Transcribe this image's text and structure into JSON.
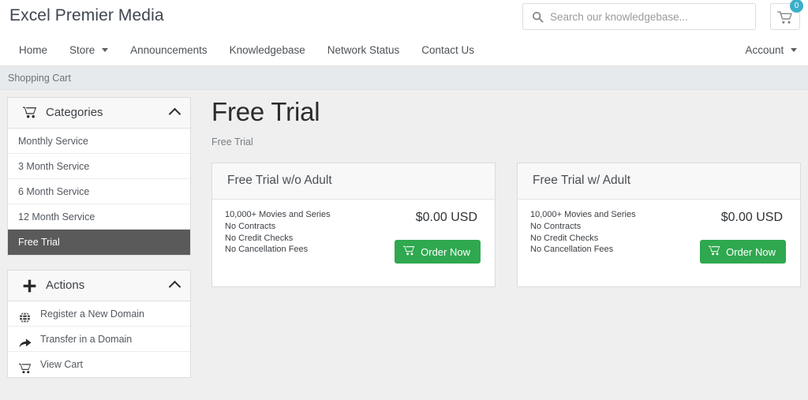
{
  "header": {
    "brand": "Excel Premier Media",
    "search_placeholder": "Search our knowledgebase...",
    "search_value": "",
    "cart_count": "0"
  },
  "nav": {
    "items": [
      {
        "label": "Home",
        "has_caret": false
      },
      {
        "label": "Store",
        "has_caret": true
      },
      {
        "label": "Announcements",
        "has_caret": false
      },
      {
        "label": "Knowledgebase",
        "has_caret": false
      },
      {
        "label": "Network Status",
        "has_caret": false
      },
      {
        "label": "Contact Us",
        "has_caret": false
      }
    ],
    "account_label": "Account"
  },
  "breadcrumb": {
    "text": "Shopping Cart"
  },
  "sidebar": {
    "categories": {
      "title": "Categories",
      "items": [
        {
          "label": "Monthly Service",
          "active": false
        },
        {
          "label": "3 Month Service",
          "active": false
        },
        {
          "label": "6 Month Service",
          "active": false
        },
        {
          "label": "12 Month Service",
          "active": false
        },
        {
          "label": "Free Trial",
          "active": true
        }
      ]
    },
    "actions": {
      "title": "Actions",
      "items": [
        {
          "label": "Register a New Domain",
          "icon": "globe-icon"
        },
        {
          "label": "Transfer in a Domain",
          "icon": "share-arrow-icon"
        },
        {
          "label": "View Cart",
          "icon": "cart-icon"
        }
      ]
    }
  },
  "main": {
    "title": "Free Trial",
    "subtitle": "Free Trial",
    "products": [
      {
        "name": "Free Trial w/o Adult",
        "features": [
          "10,000+ Movies and Series",
          "No Contracts",
          "No Credit Checks",
          "No Cancellation Fees"
        ],
        "price": "$0.00 USD",
        "order_label": "Order Now"
      },
      {
        "name": "Free Trial w/ Adult",
        "features": [
          "10,000+ Movies and Series",
          "No Contracts",
          "No Credit Checks",
          "No Cancellation Fees"
        ],
        "price": "$0.00 USD",
        "order_label": "Order Now"
      }
    ]
  },
  "colors": {
    "accent_green": "#2fa84f",
    "badge_teal": "#3aafc9",
    "active_gray": "#5a5a5a",
    "page_bg": "#efefef",
    "breadcrumb_bg": "#e6eaed"
  }
}
